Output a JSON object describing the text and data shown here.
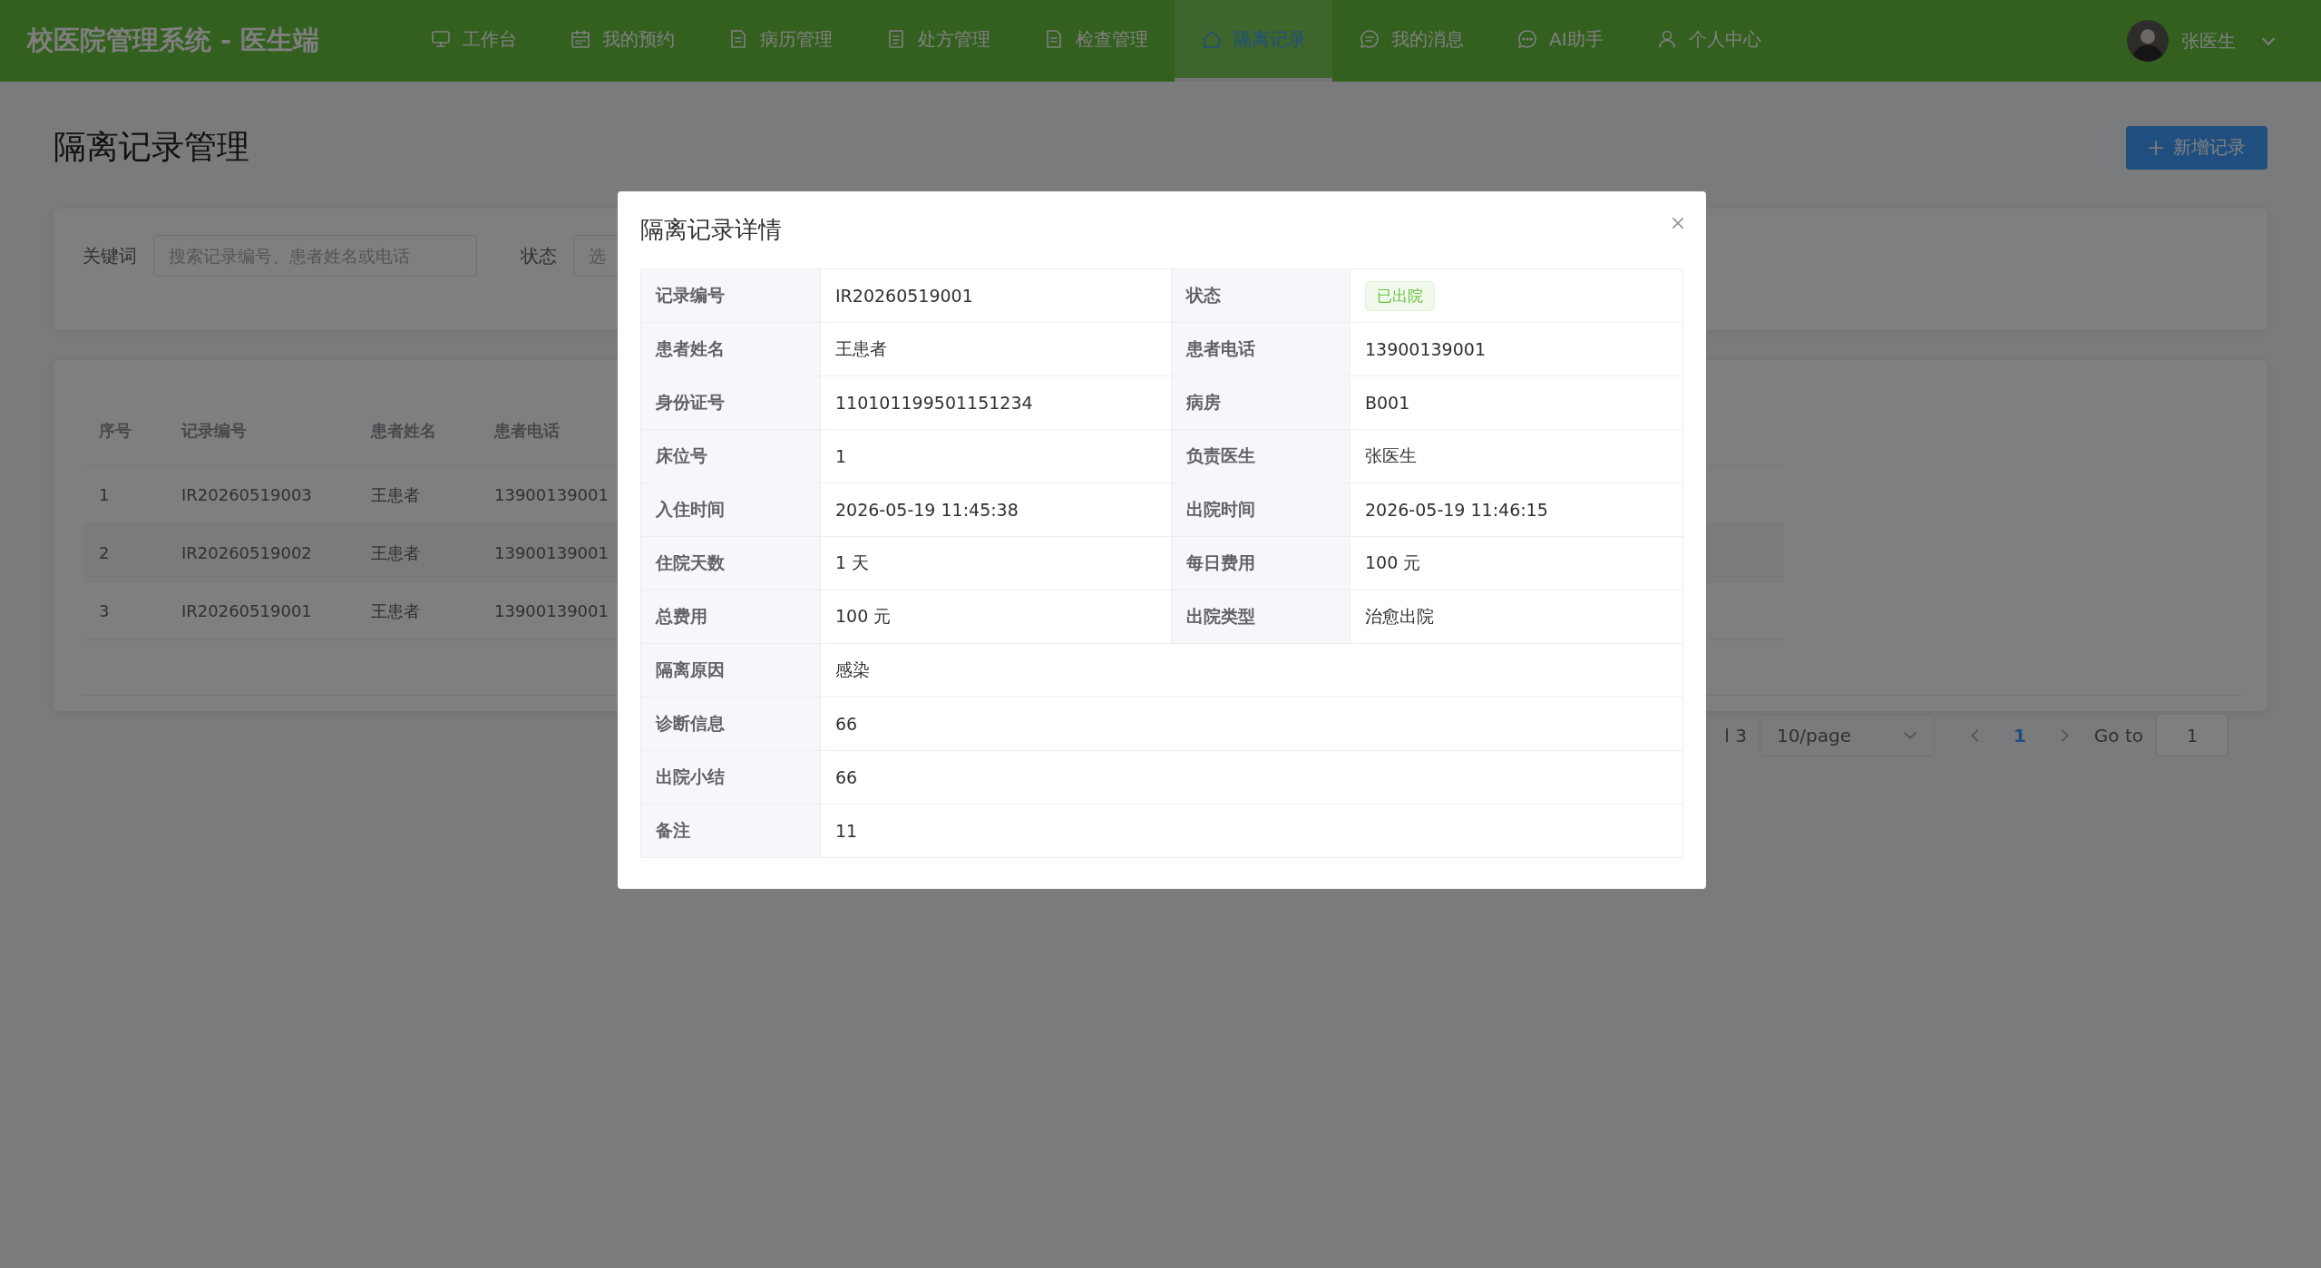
{
  "header": {
    "title": "校医院管理系统 - 医生端",
    "nav": [
      {
        "label": "工作台",
        "selected": false
      },
      {
        "label": "我的预约",
        "selected": false
      },
      {
        "label": "病历管理",
        "selected": false
      },
      {
        "label": "处方管理",
        "selected": false
      },
      {
        "label": "检查管理",
        "selected": false
      },
      {
        "label": "隔离记录",
        "selected": true
      },
      {
        "label": "我的消息",
        "selected": false
      },
      {
        "label": "AI助手",
        "selected": false
      },
      {
        "label": "个人中心",
        "selected": false
      }
    ],
    "user": {
      "name": "张医生"
    }
  },
  "page": {
    "title": "隔离记录管理",
    "add_button": "新增记录"
  },
  "filters": {
    "keyword_label": "关键词",
    "keyword_placeholder": "搜索记录编号、患者姓名或电话",
    "status_label": "状态",
    "status_placeholder": "选"
  },
  "table": {
    "columns": [
      "序号",
      "记录编号",
      "患者姓名",
      "患者电话"
    ],
    "rows": [
      [
        "1",
        "IR20260519003",
        "王患者",
        "13900139001"
      ],
      [
        "2",
        "IR20260519002",
        "王患者",
        "13900139001"
      ],
      [
        "3",
        "IR20260519001",
        "王患者",
        "13900139001"
      ]
    ]
  },
  "pagination": {
    "total_text": "l 3",
    "page_size": "10/page",
    "pages": [
      {
        "label": "1",
        "selected": true
      }
    ],
    "goto_label": "Go to",
    "goto_value": "1"
  },
  "dialog": {
    "title": "隔离记录详情",
    "fields": [
      {
        "label": "记录编号",
        "value": "IR20260519001",
        "kind": "text",
        "wide": false
      },
      {
        "label": "状态",
        "value": "已出院",
        "kind": "tag",
        "wide": false
      },
      {
        "label": "患者姓名",
        "value": "王患者",
        "kind": "text",
        "wide": false
      },
      {
        "label": "患者电话",
        "value": "13900139001",
        "kind": "text",
        "wide": false
      },
      {
        "label": "身份证号",
        "value": "110101199501151234",
        "kind": "text",
        "wide": false
      },
      {
        "label": "病房",
        "value": "B001",
        "kind": "text",
        "wide": false
      },
      {
        "label": "床位号",
        "value": "1",
        "kind": "text",
        "wide": false
      },
      {
        "label": "负责医生",
        "value": "张医生",
        "kind": "text",
        "wide": false
      },
      {
        "label": "入住时间",
        "value": "2026-05-19 11:45:38",
        "kind": "text",
        "wide": false
      },
      {
        "label": "出院时间",
        "value": "2026-05-19 11:46:15",
        "kind": "text",
        "wide": false
      },
      {
        "label": "住院天数",
        "value": "1 天",
        "kind": "text",
        "wide": false
      },
      {
        "label": "每日费用",
        "value": "100 元",
        "kind": "text",
        "wide": false
      },
      {
        "label": "总费用",
        "value": "100 元",
        "kind": "text",
        "wide": false
      },
      {
        "label": "出院类型",
        "value": "治愈出院",
        "kind": "text",
        "wide": false
      },
      {
        "label": "隔离原因",
        "value": "感染",
        "kind": "text",
        "wide": true
      },
      {
        "label": "诊断信息",
        "value": "66",
        "kind": "text",
        "wide": true
      },
      {
        "label": "出院小结",
        "value": "66",
        "kind": "text",
        "wide": true
      },
      {
        "label": "备注",
        "value": "11",
        "kind": "text",
        "wide": true
      }
    ]
  }
}
